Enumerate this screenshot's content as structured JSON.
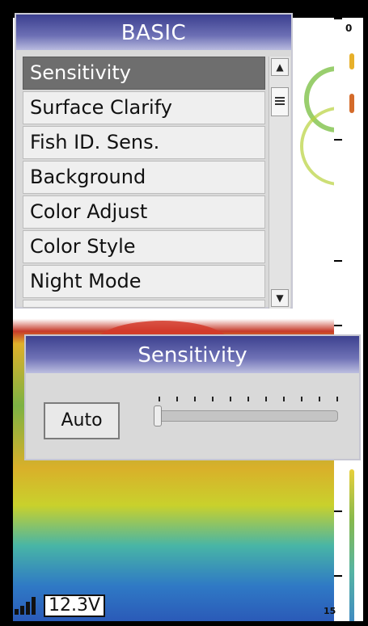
{
  "menu": {
    "title": "BASIC",
    "items": [
      {
        "label": "Sensitivity",
        "selected": true
      },
      {
        "label": "Surface Clarify"
      },
      {
        "label": "Fish ID. Sens."
      },
      {
        "label": "Background"
      },
      {
        "label": "Color Adjust"
      },
      {
        "label": "Color Style"
      },
      {
        "label": "Night Mode"
      }
    ],
    "scroll_up_icon": "triangle-up-icon",
    "scroll_down_icon": "triangle-down-icon"
  },
  "dialog": {
    "title": "Sensitivity",
    "auto_label": "Auto",
    "slider_level": 0,
    "tick_count": 11
  },
  "scale": {
    "top_label": "0",
    "bottom_label": "15"
  },
  "status": {
    "voltage": "12.3V",
    "signal_icon": "signal-strength-icon"
  },
  "colors": {
    "header_blue": "#3b3f8f",
    "selected_row": "#6e6e6e"
  }
}
